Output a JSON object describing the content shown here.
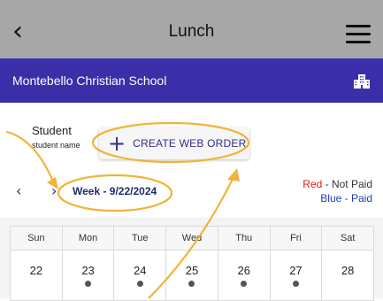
{
  "topbar": {
    "title": "Lunch",
    "back_icon": "chevron-left-icon",
    "menu_icon": "hamburger-menu-icon"
  },
  "school": {
    "name": "Montebello Christian School",
    "icon": "building-icon"
  },
  "student": {
    "label": "Student",
    "name": "student name",
    "create_order_label": "CREATE WEB ORDER"
  },
  "week": {
    "label": "Week - 9/22/2024",
    "legend": {
      "red_word": "Red",
      "red_rest": " - Not Paid",
      "blue_word": "Blue",
      "blue_rest": " - Paid"
    }
  },
  "calendar": {
    "days": [
      {
        "name": "Sun",
        "date": "22",
        "dot": false
      },
      {
        "name": "Mon",
        "date": "23",
        "dot": true
      },
      {
        "name": "Tue",
        "date": "24",
        "dot": true
      },
      {
        "name": "Wed",
        "date": "25",
        "dot": true
      },
      {
        "name": "Thu",
        "date": "26",
        "dot": true
      },
      {
        "name": "Fri",
        "date": "27",
        "dot": true
      },
      {
        "name": "Sat",
        "date": "28",
        "dot": false
      }
    ]
  },
  "colors": {
    "topbar": "#a7a7a7",
    "schoolbar": "#3a2fa8",
    "annotation": "#f0b43a",
    "legend_red": "#e01b1b",
    "legend_blue": "#1f3fb5"
  }
}
